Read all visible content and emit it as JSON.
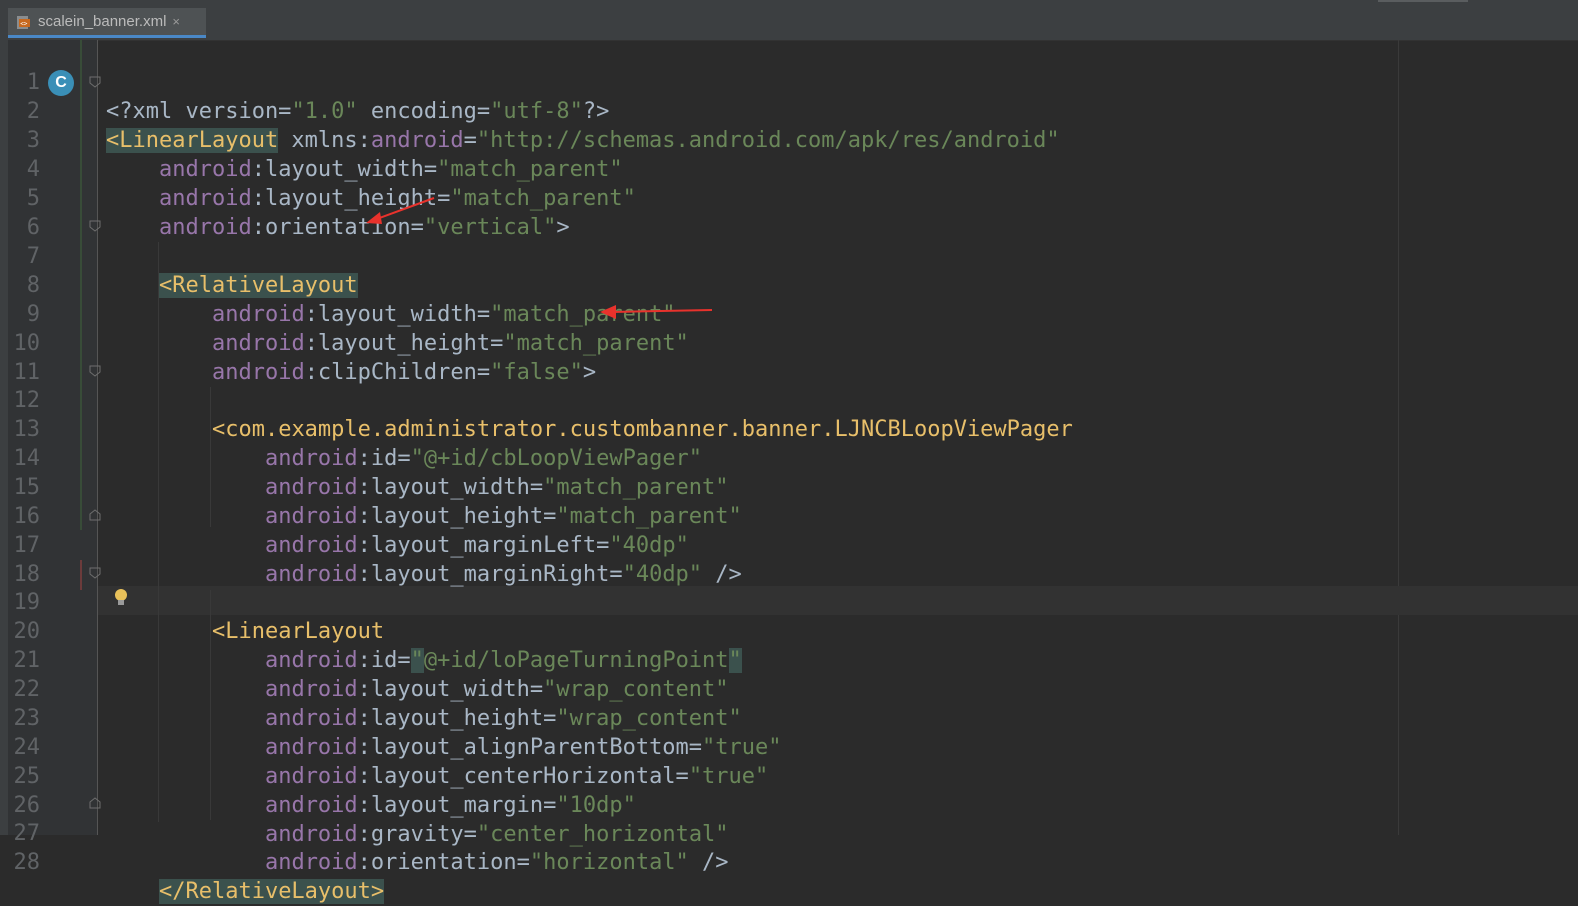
{
  "tab": {
    "filename": "scalein_banner.xml",
    "close": "×"
  },
  "gutter": {
    "class_badge": "C"
  },
  "lines": [
    {
      "n": "1"
    },
    {
      "n": "2"
    },
    {
      "n": "3"
    },
    {
      "n": "4"
    },
    {
      "n": "5"
    },
    {
      "n": "6"
    },
    {
      "n": "7"
    },
    {
      "n": "8"
    },
    {
      "n": "9"
    },
    {
      "n": "10"
    },
    {
      "n": "11"
    },
    {
      "n": "12"
    },
    {
      "n": "13"
    },
    {
      "n": "14"
    },
    {
      "n": "15"
    },
    {
      "n": "16"
    },
    {
      "n": "17"
    },
    {
      "n": "18"
    },
    {
      "n": "19"
    },
    {
      "n": "20"
    },
    {
      "n": "21"
    },
    {
      "n": "22"
    },
    {
      "n": "23"
    },
    {
      "n": "24"
    },
    {
      "n": "25"
    },
    {
      "n": "26"
    },
    {
      "n": "27"
    },
    {
      "n": "28"
    }
  ],
  "code": {
    "l1": {
      "a": "<?xml version=",
      "b": "\"1.0\"",
      "c": " encoding=",
      "d": "\"utf-8\"",
      "e": "?>"
    },
    "l2": {
      "tag": "<LinearLayout",
      "sp": " xmlns:",
      "ns": "android",
      "eq": "=",
      "val": "\"http://schemas.android.com/apk/res/android\""
    },
    "l3": {
      "ns": "android",
      ":": ":",
      "attr": "layout_width=",
      "val": "\"match_parent\""
    },
    "l4": {
      "ns": "android",
      "attr": ":layout_height=",
      "val": "\"match_parent\""
    },
    "l5": {
      "ns": "android",
      "attr": ":orientation=",
      "val": "\"vertical\"",
      "end": ">"
    },
    "l7": {
      "tag": "<RelativeLayout"
    },
    "l8": {
      "ns": "android",
      "attr": ":layout_width=",
      "val": "\"match_parent\""
    },
    "l9": {
      "ns": "android",
      "attr": ":layout_height=",
      "val": "\"match_parent\""
    },
    "l10": {
      "ns": "android",
      "attr": ":clipChildren=",
      "val": "\"false\"",
      "end": ">"
    },
    "l12": {
      "tag": "<com.example.administrator.custombanner.banner.LJNCBLoopViewPager"
    },
    "l13": {
      "ns": "android",
      "attr": ":id=",
      "val": "\"@+id/cbLoopViewPager\""
    },
    "l14": {
      "ns": "android",
      "attr": ":layout_width=",
      "val": "\"match_parent\""
    },
    "l15": {
      "ns": "android",
      "attr": ":layout_height=",
      "val": "\"match_parent\""
    },
    "l16": {
      "ns": "android",
      "attr": ":layout_marginLeft=",
      "val": "\"40dp\""
    },
    "l17": {
      "ns": "android",
      "attr": ":layout_marginRight=",
      "val": "\"40dp\"",
      "end": " />"
    },
    "l19": {
      "tag": "<LinearLayout"
    },
    "l20": {
      "ns": "android",
      "attr": ":id=",
      "q1": "\"",
      "val": "@+id/loPageTurningPoint",
      "q2": "\""
    },
    "l21": {
      "ns": "android",
      "attr": ":layout_width=",
      "val": "\"wrap_content\""
    },
    "l22": {
      "ns": "android",
      "attr": ":layout_height=",
      "val": "\"wrap_content\""
    },
    "l23": {
      "ns": "android",
      "attr": ":layout_alignParentBottom=",
      "val": "\"true\""
    },
    "l24": {
      "ns": "android",
      "attr": ":layout_centerHorizontal=",
      "val": "\"true\""
    },
    "l25": {
      "ns": "android",
      "attr": ":layout_margin=",
      "val": "\"10dp\""
    },
    "l26": {
      "ns": "android",
      "attr": ":gravity=",
      "val": "\"center_horizontal\""
    },
    "l27": {
      "ns": "android",
      "attr": ":orientation=",
      "val": "\"horizontal\"",
      "end": " />"
    },
    "l28": {
      "tag": "</RelativeLayout>"
    }
  },
  "colors": {
    "background": "#2b2b2b",
    "tag": "#e8bf6a",
    "namespace": "#9876aa",
    "value": "#6a8759",
    "text": "#a9b7c6",
    "annotation_arrow": "#e8322c"
  },
  "icons": {
    "file": "xml-file-icon",
    "badge": "class-badge-icon",
    "bulb": "lightbulb-icon",
    "fold": "fold-marker-icon"
  }
}
